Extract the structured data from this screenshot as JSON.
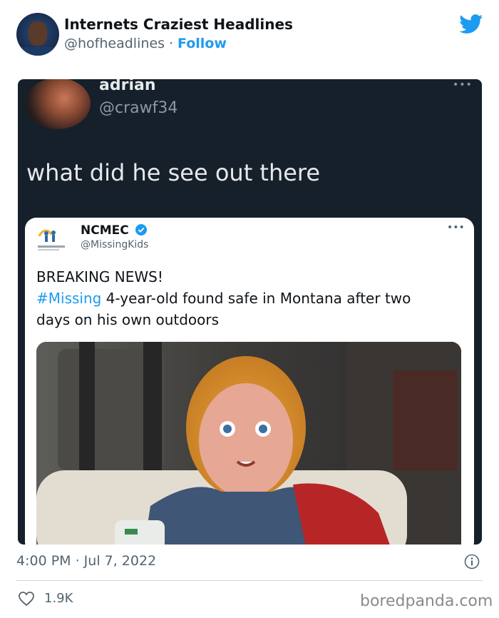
{
  "tweet": {
    "author_name": "Internets Craziest Headlines",
    "author_handle": "@hofheadlines",
    "separator": "·",
    "follow_label": "Follow",
    "timestamp": "4:00 PM · Jul 7, 2022",
    "like_count": "1.9K"
  },
  "screenshot": {
    "author_name": "adrian",
    "author_handle": "@crawf34",
    "more_label": "•••",
    "text": "what did he see out there",
    "quoted": {
      "author_name": "NCMEC",
      "author_handle": "@MissingKids",
      "more_label": "•••",
      "line1": "BREAKING NEWS!",
      "hashtag": "#Missing",
      "line2_rest": " 4-year-old found safe in Montana after two",
      "line3": "days on his own outdoors"
    }
  },
  "watermark": "boredpanda.com",
  "colors": {
    "accent": "#1d9bf0",
    "dark_bg": "#15202b",
    "muted": "#536471"
  },
  "icons": {
    "logo": "twitter-bird-icon",
    "info": "info-icon",
    "like": "heart-icon",
    "verified": "verified-badge-icon"
  }
}
